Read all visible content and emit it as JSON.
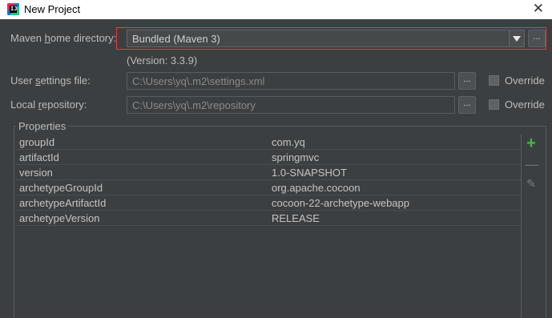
{
  "window": {
    "title": "New Project",
    "app_icon_text": "IJ",
    "close_glyph": "✕"
  },
  "maven_home": {
    "label_pre": "Maven ",
    "label_mnemonic": "h",
    "label_post": "ome directory:",
    "value": "Bundled (Maven 3)",
    "version": "(Version: 3.3.9)",
    "browse_label": "..."
  },
  "user_settings": {
    "label_pre": "User ",
    "label_mnemonic": "s",
    "label_post": "ettings file:",
    "value": "C:\\Users\\yq\\.m2\\settings.xml",
    "browse_label": "...",
    "override_label": "Override",
    "override_checked": false
  },
  "local_repo": {
    "label_pre": "Local ",
    "label_mnemonic": "r",
    "label_post": "epository:",
    "value": "C:\\Users\\yq\\.m2\\repository",
    "browse_label": "...",
    "override_label": "Override",
    "override_checked": false
  },
  "properties": {
    "legend": "Properties",
    "rows": [
      {
        "key": "groupId",
        "value": "com.yq"
      },
      {
        "key": "artifactId",
        "value": "springmvc"
      },
      {
        "key": "version",
        "value": "1.0-SNAPSHOT"
      },
      {
        "key": "archetypeGroupId",
        "value": "org.apache.cocoon"
      },
      {
        "key": "archetypeArtifactId",
        "value": "cocoon-22-archetype-webapp"
      },
      {
        "key": "archetypeVersion",
        "value": "RELEASE"
      }
    ],
    "tools": {
      "add": "+",
      "remove": "—",
      "edit": "✎"
    }
  },
  "colors": {
    "highlight": "#e0403f",
    "add_icon": "#3fbf3f",
    "background": "#3c3f41"
  }
}
